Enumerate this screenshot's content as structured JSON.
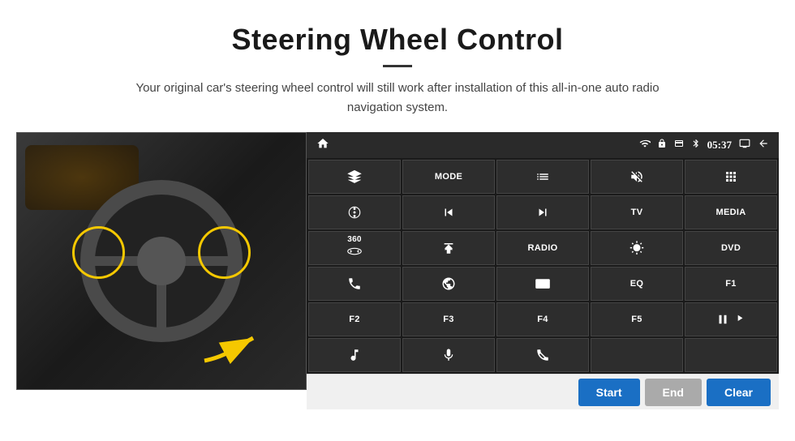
{
  "header": {
    "title": "Steering Wheel Control",
    "subtitle": "Your original car's steering wheel control will still work after installation of this all-in-one auto radio navigation system."
  },
  "status_bar": {
    "time": "05:37",
    "icons": [
      "wifi",
      "lock",
      "card",
      "bluetooth",
      "monitor",
      "back"
    ]
  },
  "button_grid": [
    [
      {
        "id": "nav",
        "label": "",
        "icon": "home"
      },
      {
        "id": "mode",
        "label": "MODE",
        "icon": null
      },
      {
        "id": "list",
        "label": "",
        "icon": "list"
      },
      {
        "id": "mute",
        "label": "",
        "icon": "mute"
      },
      {
        "id": "apps",
        "label": "",
        "icon": "apps"
      }
    ],
    [
      {
        "id": "settings",
        "label": "",
        "icon": "gear"
      },
      {
        "id": "prev",
        "label": "",
        "icon": "prev"
      },
      {
        "id": "next",
        "label": "",
        "icon": "next"
      },
      {
        "id": "tv",
        "label": "TV",
        "icon": null
      },
      {
        "id": "media",
        "label": "MEDIA",
        "icon": null
      }
    ],
    [
      {
        "id": "cam360",
        "label": "360",
        "icon": "camera360"
      },
      {
        "id": "eject",
        "label": "",
        "icon": "eject"
      },
      {
        "id": "radio",
        "label": "RADIO",
        "icon": null
      },
      {
        "id": "brightness",
        "label": "",
        "icon": "brightness"
      },
      {
        "id": "dvd",
        "label": "DVD",
        "icon": null
      }
    ],
    [
      {
        "id": "phone",
        "label": "",
        "icon": "phone"
      },
      {
        "id": "globe",
        "label": "",
        "icon": "globe"
      },
      {
        "id": "screen",
        "label": "",
        "icon": "screen"
      },
      {
        "id": "eq",
        "label": "EQ",
        "icon": null
      },
      {
        "id": "f1",
        "label": "F1",
        "icon": null
      }
    ],
    [
      {
        "id": "f2",
        "label": "F2",
        "icon": null
      },
      {
        "id": "f3",
        "label": "F3",
        "icon": null
      },
      {
        "id": "f4",
        "label": "F4",
        "icon": null
      },
      {
        "id": "f5",
        "label": "F5",
        "icon": null
      },
      {
        "id": "playpause",
        "label": "",
        "icon": "playpause"
      }
    ],
    [
      {
        "id": "music",
        "label": "",
        "icon": "music"
      },
      {
        "id": "mic",
        "label": "",
        "icon": "mic"
      },
      {
        "id": "hangup",
        "label": "",
        "icon": "hangup"
      },
      {
        "id": "empty1",
        "label": "",
        "icon": null
      },
      {
        "id": "empty2",
        "label": "",
        "icon": null
      }
    ]
  ],
  "bottom_bar": {
    "start_label": "Start",
    "end_label": "End",
    "clear_label": "Clear"
  }
}
